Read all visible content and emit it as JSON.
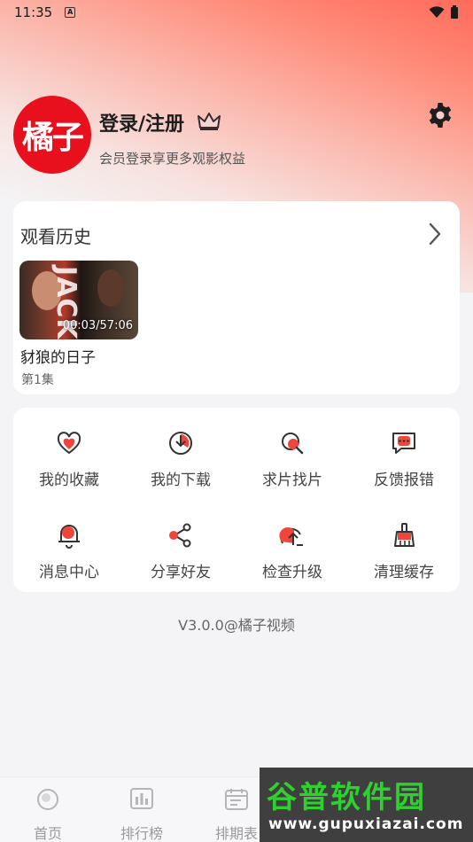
{
  "status_bar": {
    "time": "11:35",
    "a_badge": "A"
  },
  "profile": {
    "avatar_text": "橘子",
    "login_title": "登录/注册",
    "login_subtitle": "会员登录享更多观影权益"
  },
  "history": {
    "title": "观看历史",
    "items": [
      {
        "name": "豺狼的日子",
        "episode": "第1集",
        "progress": "00:03/57:06",
        "poster_text": "JACKAL"
      }
    ]
  },
  "features": [
    {
      "label": "我的收藏",
      "icon": "heart-icon"
    },
    {
      "label": "我的下载",
      "icon": "download-icon"
    },
    {
      "label": "求片找片",
      "icon": "search-film-icon"
    },
    {
      "label": "反馈报错",
      "icon": "feedback-icon"
    },
    {
      "label": "消息中心",
      "icon": "bell-icon"
    },
    {
      "label": "分享好友",
      "icon": "share-icon"
    },
    {
      "label": "检查升级",
      "icon": "upgrade-icon"
    },
    {
      "label": "清理缓存",
      "icon": "broom-icon"
    }
  ],
  "version": "V3.0.0@橘子视频",
  "tabbar": [
    {
      "label": "首页",
      "icon": "home-icon"
    },
    {
      "label": "排行榜",
      "icon": "ranking-icon"
    },
    {
      "label": "排期表",
      "icon": "calendar-icon"
    }
  ],
  "watermark": {
    "text": "谷普软件园",
    "url": "www.gupuxiazai.com"
  },
  "colors": {
    "accent": "#f0453a",
    "avatar_bg": "#e8101c"
  }
}
